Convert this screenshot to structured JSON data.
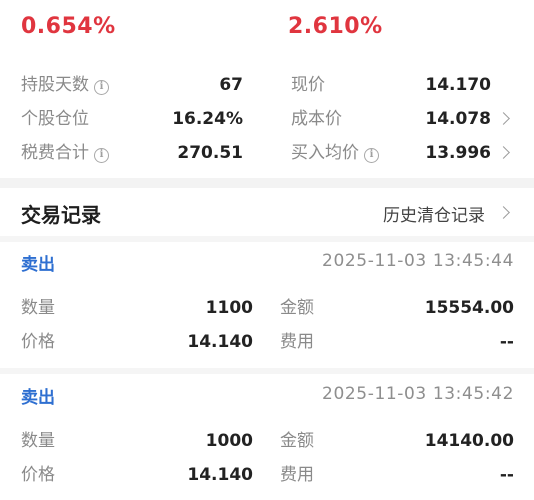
{
  "summary": {
    "pct_left": "0.654%",
    "pct_right": "2.610%"
  },
  "stats": {
    "hold_days_label": "持股天数",
    "hold_days_value": "67",
    "price_label": "现价",
    "price_value": "14.170",
    "position_label": "个股仓位",
    "position_value": "16.24%",
    "cost_label": "成本价",
    "cost_value": "14.078",
    "fees_label": "税费合计",
    "fees_value": "270.51",
    "avg_buy_label": "买入均价",
    "avg_buy_value": "13.996",
    "info_glyph": "i"
  },
  "trades": {
    "title": "交易记录",
    "history_link": "历史清仓记录",
    "records": [
      {
        "type": "卖出",
        "time": "2025-11-03 13:45:44",
        "qty_label": "数量",
        "qty": "1100",
        "amount_label": "金额",
        "amount": "15554.00",
        "price_label": "价格",
        "price": "14.140",
        "fee_label": "费用",
        "fee": "--"
      },
      {
        "type": "卖出",
        "time": "2025-11-03 13:45:42",
        "qty_label": "数量",
        "qty": "1000",
        "amount_label": "金额",
        "amount": "14140.00",
        "price_label": "价格",
        "price": "14.140",
        "fee_label": "费用",
        "fee": "--"
      }
    ]
  },
  "colors": {
    "positive": "#e0353f",
    "action_link": "#2e6fd1"
  }
}
